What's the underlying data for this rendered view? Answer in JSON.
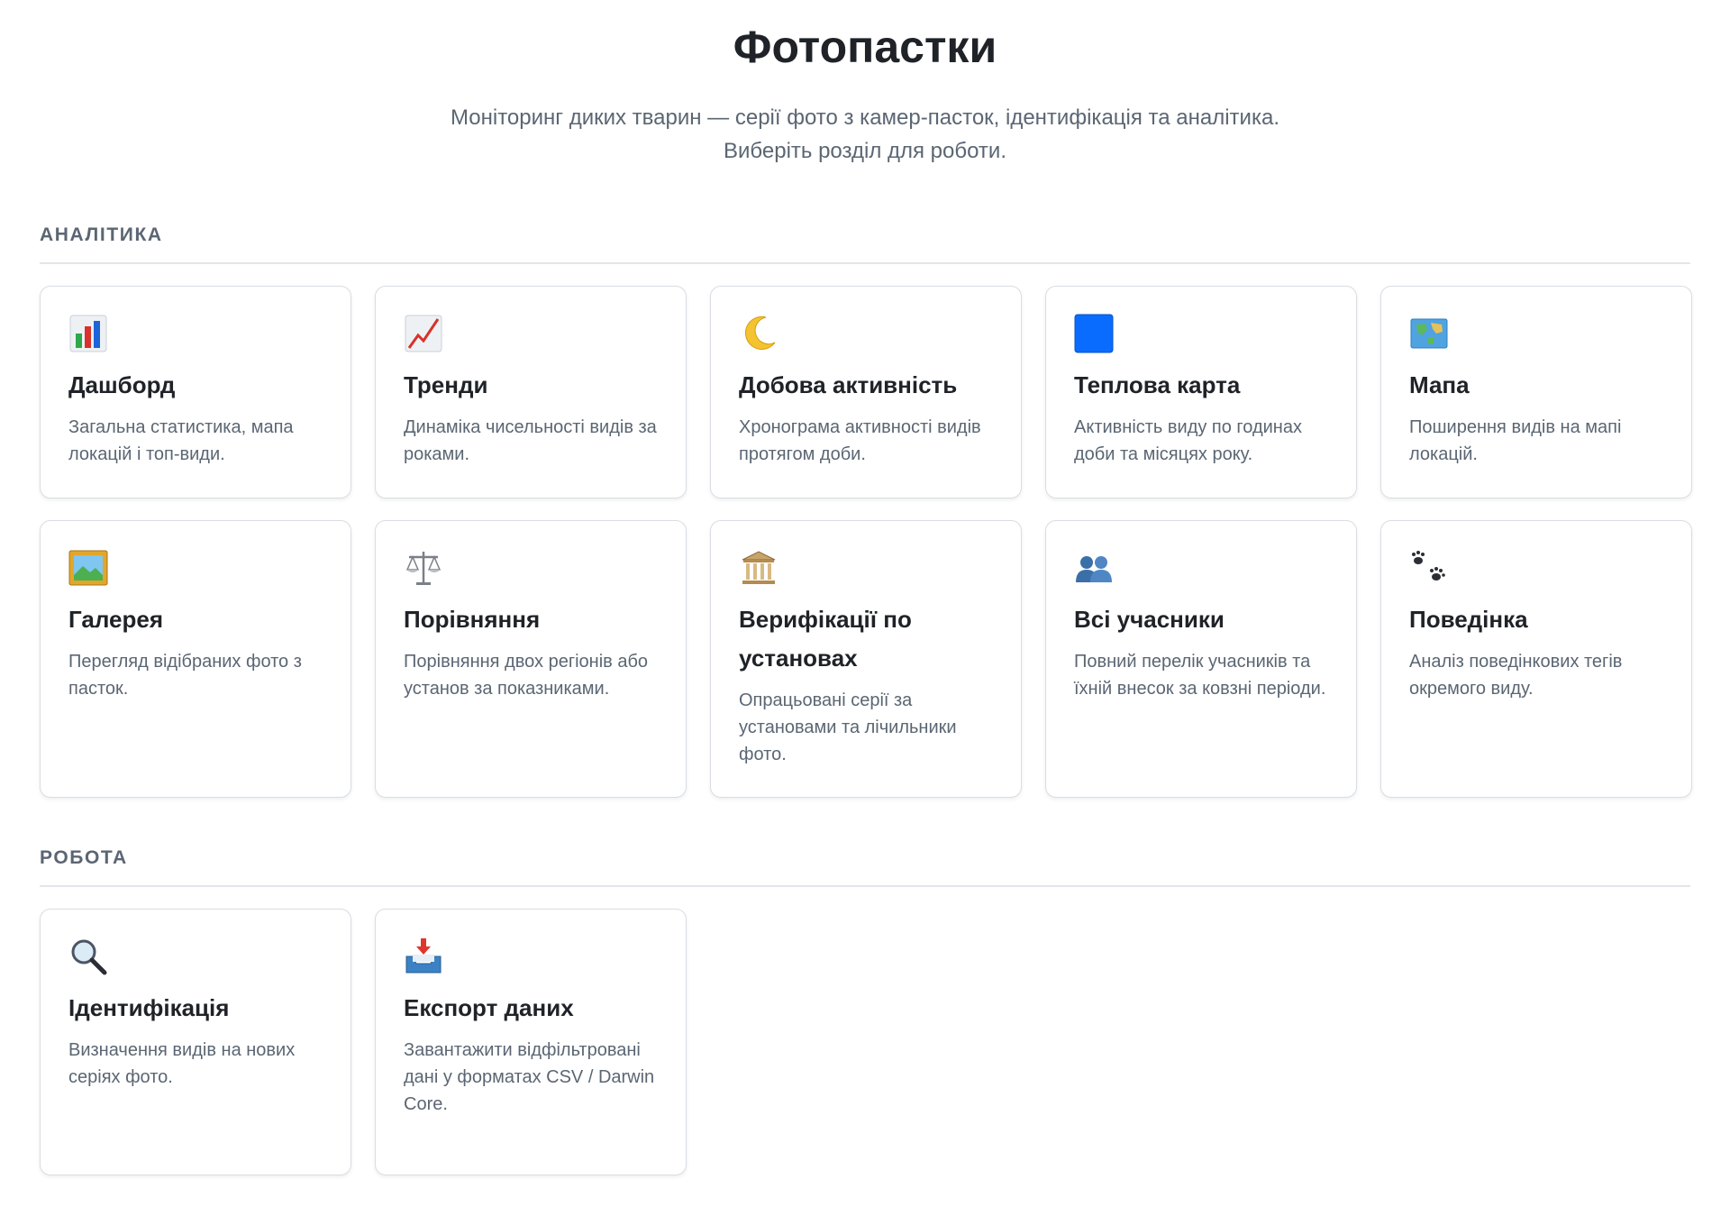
{
  "header": {
    "title": "Фотопастки",
    "subtitle_line1": "Моніторинг диких тварин — серії фото з камер-пасток, ідентифікація та аналітика.",
    "subtitle_line2": "Виберіть розділ для роботи."
  },
  "sections": {
    "analytics": {
      "title": "АНАЛІТИКА",
      "cards": [
        {
          "icon": "bar-chart-icon",
          "title": "Дашборд",
          "desc": "Загальна статистика, мапа локацій і топ-види."
        },
        {
          "icon": "trend-chart-icon",
          "title": "Тренди",
          "desc": "Динаміка чисельності видів за роками."
        },
        {
          "icon": "moon-icon",
          "title": "Добова активність",
          "desc": "Хронограма активності видів протягом доби."
        },
        {
          "icon": "blue-square-icon",
          "title": "Теплова карта",
          "desc": "Активність виду по годинах доби та місяцях року."
        },
        {
          "icon": "world-map-icon",
          "title": "Мапа",
          "desc": "Поширення видів на мапі локацій."
        },
        {
          "icon": "framed-picture-icon",
          "title": "Галерея",
          "desc": "Перегляд відібраних фото з пасток."
        },
        {
          "icon": "balance-scale-icon",
          "title": "Порівняння",
          "desc": "Порівняння двох регіонів або установ за показниками."
        },
        {
          "icon": "institution-building-icon",
          "title": "Верифікації по установах",
          "desc": "Опрацьовані серії за установами та лічильники фото."
        },
        {
          "icon": "people-icon",
          "title": "Всі учасники",
          "desc": "Повний перелік учасників та їхній внесок за ковзні періоди."
        },
        {
          "icon": "paw-prints-icon",
          "title": "Поведінка",
          "desc": "Аналіз поведінкових тегів окремого виду."
        }
      ]
    },
    "work": {
      "title": "РОБОТА",
      "cards": [
        {
          "icon": "magnifier-icon",
          "title": "Ідентифікація",
          "desc": "Визначення видів на нових серіях фото."
        },
        {
          "icon": "inbox-download-icon",
          "title": "Експорт даних",
          "desc": "Завантажити відфільтровані дані у форматах CSV / Darwin Core."
        }
      ]
    }
  }
}
